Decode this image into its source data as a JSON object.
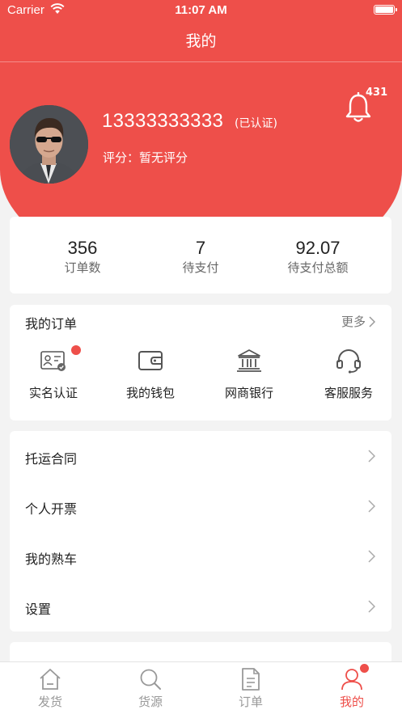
{
  "status_bar": {
    "carrier": "Carrier",
    "time": "11:07 AM"
  },
  "nav": {
    "title": "我的"
  },
  "profile": {
    "phone": "13333333333",
    "verified_tag": "(已认证)",
    "rating": "评分：暂无评分",
    "notification_count": "431"
  },
  "stats": [
    {
      "value": "356",
      "label": "订单数"
    },
    {
      "value": "7",
      "label": "待支付"
    },
    {
      "value": "92.07",
      "label": "待支付总额"
    }
  ],
  "orders": {
    "title": "我的订单",
    "more": "更多",
    "items": [
      {
        "label": "实名认证",
        "icon": "id-card-icon",
        "has_badge": true
      },
      {
        "label": "我的钱包",
        "icon": "wallet-icon",
        "has_badge": false
      },
      {
        "label": "网商银行",
        "icon": "bank-icon",
        "has_badge": false
      },
      {
        "label": "客服服务",
        "icon": "headset-icon",
        "has_badge": false
      }
    ]
  },
  "menu": [
    {
      "label": "托运合同"
    },
    {
      "label": "个人开票"
    },
    {
      "label": "我的熟车"
    },
    {
      "label": "设置"
    }
  ],
  "tabbar": [
    {
      "label": "发货",
      "icon": "home-icon",
      "active": false
    },
    {
      "label": "货源",
      "icon": "search-icon",
      "active": false
    },
    {
      "label": "订单",
      "icon": "document-icon",
      "active": false
    },
    {
      "label": "我的",
      "icon": "user-icon",
      "active": true
    }
  ],
  "colors": {
    "accent": "#ee4f4a",
    "background": "#f3f3f3"
  }
}
